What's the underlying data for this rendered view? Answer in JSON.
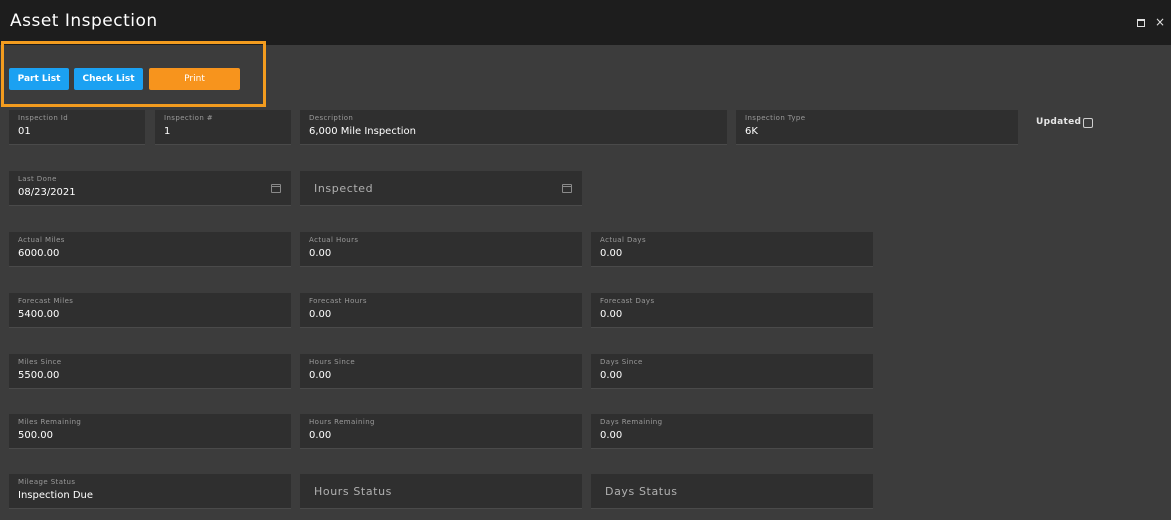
{
  "window": {
    "title": "Asset Inspection",
    "maximize_icon": "maximize-icon",
    "close_icon": "close-icon",
    "close_glyph": "×"
  },
  "toolbar": {
    "part_list_label": "Part List",
    "check_list_label": "Check List",
    "print_label": "Print"
  },
  "fields": {
    "inspection_id": {
      "label": "Inspection Id",
      "value": "01"
    },
    "inspection_num": {
      "label": "Inspection #",
      "value": "1"
    },
    "description": {
      "label": "Description",
      "value": "6,000 Mile Inspection"
    },
    "inspection_type": {
      "label": "Inspection Type",
      "value": "6K"
    },
    "last_done": {
      "label": "Last Done",
      "value": "08/23/2021"
    },
    "inspected": {
      "placeholder": "Inspected"
    },
    "actual_miles": {
      "label": "Actual Miles",
      "value": "6000.00"
    },
    "actual_hours": {
      "label": "Actual Hours",
      "value": "0.00"
    },
    "actual_days": {
      "label": "Actual Days",
      "value": "0.00"
    },
    "forecast_miles": {
      "label": "Forecast Miles",
      "value": "5400.00"
    },
    "forecast_hours": {
      "label": "Forecast Hours",
      "value": "0.00"
    },
    "forecast_days": {
      "label": "Forecast Days",
      "value": "0.00"
    },
    "miles_since": {
      "label": "Miles Since",
      "value": "5500.00"
    },
    "hours_since": {
      "label": "Hours Since",
      "value": "0.00"
    },
    "days_since": {
      "label": "Days Since",
      "value": "0.00"
    },
    "miles_remaining": {
      "label": "Miles Remaining",
      "value": "500.00"
    },
    "hours_remaining": {
      "label": "Hours Remaining",
      "value": "0.00"
    },
    "days_remaining": {
      "label": "Days Remaining",
      "value": "0.00"
    },
    "mileage_status": {
      "label": "Mileage Status",
      "value": "Inspection Due"
    },
    "hours_status": {
      "placeholder": "Hours Status"
    },
    "days_status": {
      "placeholder": "Days Status"
    }
  },
  "updated": {
    "label": "Updated",
    "checked": false
  },
  "colors": {
    "accent_blue": "#1ba1f2",
    "accent_orange": "#f7941d",
    "background": "#3c3c3c",
    "titlebar": "#1d1d1d"
  }
}
